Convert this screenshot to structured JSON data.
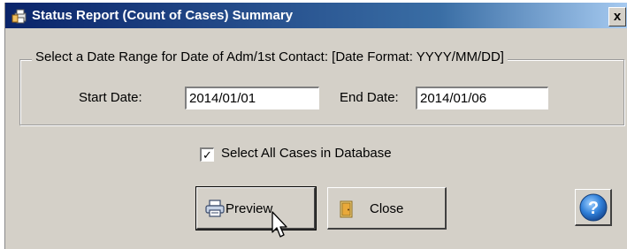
{
  "window": {
    "title": "Status Report (Count of Cases) Summary",
    "close_glyph": "x"
  },
  "date_group": {
    "legend": "Select a Date Range for Date of Adm/1st Contact: [Date Format: YYYY/MM/DD]",
    "start_label": "Start Date:",
    "start_value": "2014/01/01",
    "end_label": "End Date:",
    "end_value": "2014/01/06"
  },
  "select_all": {
    "label": "Select All Cases in Database",
    "checked": true,
    "check_glyph": "✓"
  },
  "buttons": {
    "preview": {
      "label": "Preview",
      "icon": "printer-icon"
    },
    "close": {
      "label": "Close",
      "icon": "door-icon"
    },
    "help": {
      "label": "?",
      "icon": "help-icon"
    }
  },
  "colors": {
    "titlebar_start": "#0a246a",
    "titlebar_end": "#a6caf0",
    "window_face": "#d4d0c8",
    "help_blue": "#2f7fd8"
  }
}
